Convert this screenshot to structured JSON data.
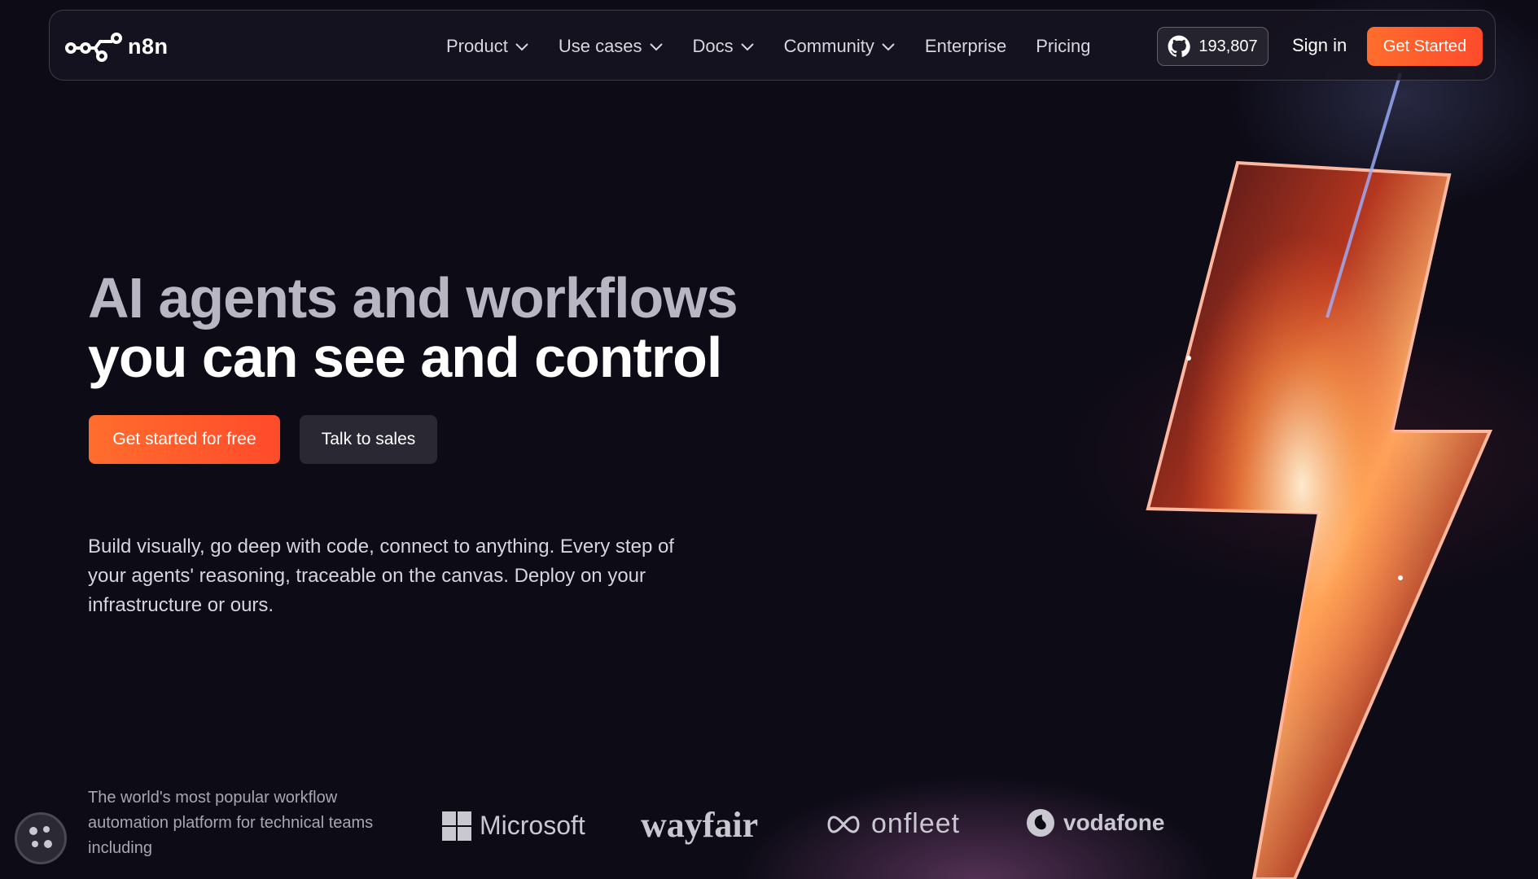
{
  "nav": {
    "logo_text": "n8n",
    "items": [
      {
        "label": "Product",
        "dropdown": true
      },
      {
        "label": "Use cases",
        "dropdown": true
      },
      {
        "label": "Docs",
        "dropdown": true
      },
      {
        "label": "Community",
        "dropdown": true
      },
      {
        "label": "Enterprise",
        "dropdown": false
      },
      {
        "label": "Pricing",
        "dropdown": false
      }
    ],
    "github_stars": "193,807",
    "github_icon": "github-icon",
    "sign_in": "Sign in",
    "get_started": "Get Started"
  },
  "hero": {
    "title_line1": "AI agents and workflows",
    "title_line2": "you can see and control",
    "cta_primary": "Get started for free",
    "cta_secondary": "Talk to sales",
    "description": "Build visually, go deep with code, connect to anything. Every step of your agents' reasoning, traceable on the canvas. Deploy on your infrastructure or ours."
  },
  "bottom": {
    "tagline": "The world's most popular workflow automation platform for technical teams including",
    "brands": [
      "Microsoft",
      "wayfair",
      "onfleet",
      "vodafone"
    ]
  },
  "colors": {
    "accent": "#ff5a2c",
    "background": "#0d0b16"
  }
}
